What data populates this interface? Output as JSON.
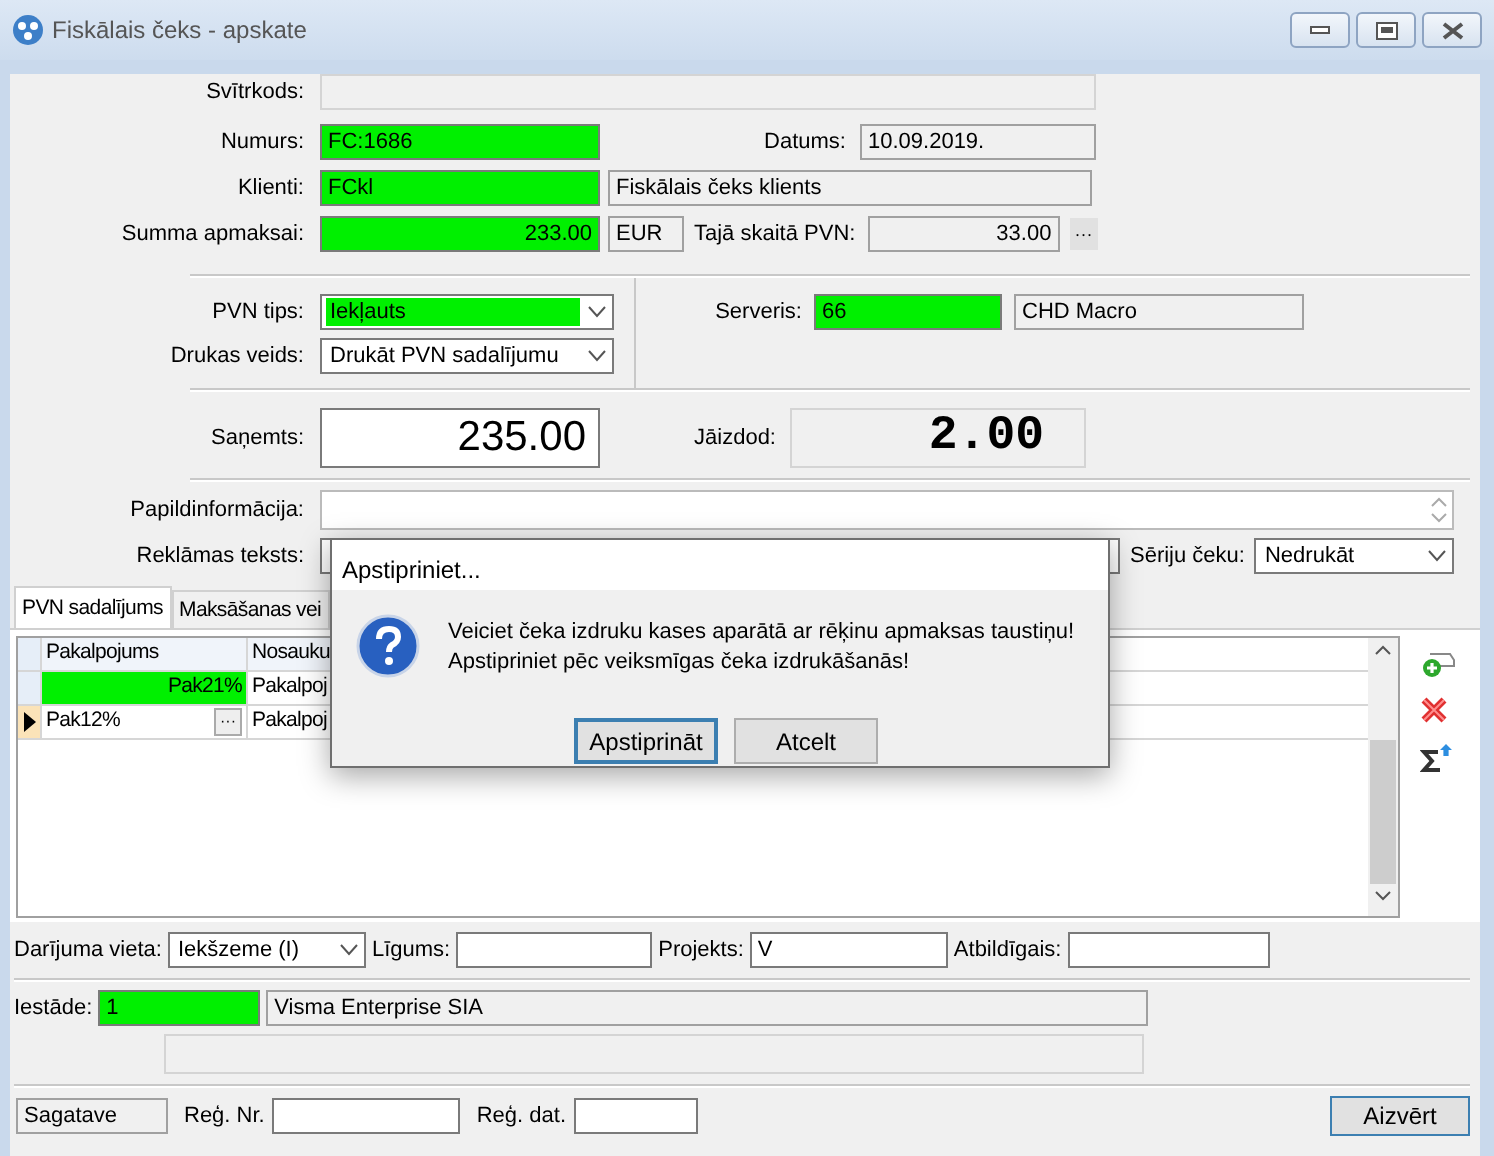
{
  "window": {
    "title": "Fiskālais čeks - apskate"
  },
  "header": {
    "svitrkods": {
      "label": "Svītrkods:",
      "readonly": true
    },
    "numurs": {
      "label": "Numurs:",
      "value": "FC:1686",
      "highlighted": true
    },
    "datums": {
      "label": "Datums:",
      "value": "10.09.2019.",
      "readonly": true
    },
    "klients": {
      "label": "Klienti:",
      "value": "FCkl",
      "highlighted": true
    },
    "klients_name": {
      "value": "Fiskālais čeks klients",
      "readonly": true
    },
    "summa": {
      "label": "Summa apmaksai:",
      "value": "233.00",
      "highlighted": true
    },
    "valuta": {
      "value": "EUR",
      "readonly": true
    },
    "pvn": {
      "label": "Tajā skaitā PVN:",
      "value": "33.00",
      "readonly": true,
      "button": "···"
    }
  },
  "fiscal": {
    "pvn_tips": {
      "label": "PVN tips:",
      "value": "Iekļauts",
      "highlighted": true
    },
    "drukas_veids": {
      "label": "Drukas veids:",
      "value": "Drukāt PVN sadalījumu"
    },
    "serveris": {
      "label": "Serveris:",
      "value": "66",
      "highlighted": true
    },
    "serveris_name": {
      "value": "CHD Macro",
      "readonly": true
    }
  },
  "payment": {
    "sanemts": {
      "label": "Saņemts:",
      "value": "235.00"
    },
    "jaizdod": {
      "label": "Jāizdod:",
      "value": "2.00",
      "readonly": true
    }
  },
  "extra": {
    "papildinformacija": {
      "label": "Papildinformācija:"
    },
    "reklamas": {
      "label": "Reklāmas teksts:"
    },
    "seriju": {
      "label": "Sēriju čeku:",
      "value": "Nedrukāt"
    }
  },
  "tabs": [
    {
      "label": "PVN sadalījums",
      "selected": true
    },
    {
      "label": "Maksāšanas vei",
      "selected": false
    }
  ],
  "grid": {
    "columns": [
      "Pakalpojums",
      "Nosauku"
    ],
    "rows": [
      {
        "cells": [
          "Pak21%",
          "Pakalpoj"
        ],
        "selected": false,
        "highlighted": true
      },
      {
        "cells": [
          "Pak12%",
          "Pakalpoj"
        ],
        "selected": true,
        "highlighted": false,
        "button": "···"
      }
    ]
  },
  "footer": {
    "darijuma_vieta": {
      "label": "Darījuma vieta:",
      "value": "Iekšzeme (I)"
    },
    "ligums": {
      "label": "Līgums:"
    },
    "projekts": {
      "label": "Projekts:",
      "value": "V"
    },
    "atbildigais": {
      "label": "Atbildīgais:"
    },
    "iestade": {
      "label": "Iestāde:",
      "value": "1",
      "highlighted": true
    },
    "iestade_name": {
      "value": "Visma Enterprise SIA",
      "readonly": true
    },
    "status": {
      "value": "Sagatave",
      "readonly": true
    },
    "reg_nr": {
      "label": "Reģ. Nr."
    },
    "reg_dat": {
      "label": "Reģ. dat."
    },
    "close": "Aizvērt"
  },
  "dialog": {
    "title": "Apstipriniet...",
    "message": [
      "Veiciet čeka izdruku kases aparātā ar rēķinu apmaksas taustiņu!",
      "Apstipriniet pēc veiksmīgas čeka izdrukāšanās!"
    ],
    "buttons": [
      {
        "label": "Apstiprināt",
        "focused": true
      },
      {
        "label": "Atcelt",
        "focused": false
      }
    ]
  }
}
